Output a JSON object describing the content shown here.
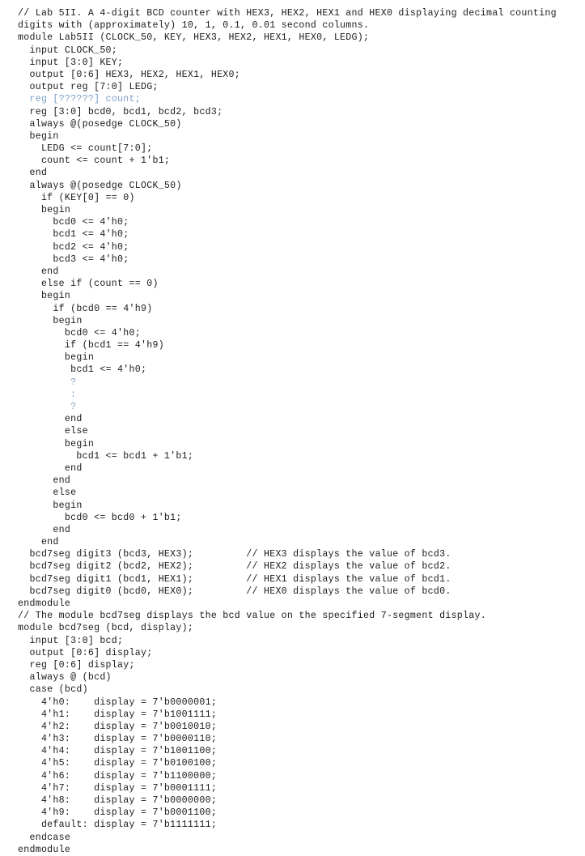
{
  "editor": {
    "language": "verilog",
    "background_color": "#ffffff",
    "text_color": "#1b1b1b",
    "highlight_color": "#7c9fc6",
    "font_kind": "monospace"
  },
  "code": {
    "lines": [
      {
        "text": "// Lab 5II. A 4-digit BCD counter with HEX3, HEX2, HEX1 and HEX0 displaying decimal counting",
        "highlighted": false
      },
      {
        "text": "digits with (approximately) 10, 1, 0.1, 0.01 second columns.",
        "highlighted": false
      },
      {
        "text": "module Lab5II (CLOCK_50, KEY, HEX3, HEX2, HEX1, HEX0, LEDG);",
        "highlighted": false
      },
      {
        "text": "  input CLOCK_50;",
        "highlighted": false
      },
      {
        "text": "  input [3:0] KEY;",
        "highlighted": false
      },
      {
        "text": "  output [0:6] HEX3, HEX2, HEX1, HEX0;",
        "highlighted": false
      },
      {
        "text": "  output reg [7:0] LEDG;",
        "highlighted": false
      },
      {
        "text": "  reg [??????] count;",
        "highlighted": true
      },
      {
        "text": "  reg [3:0] bcd0, bcd1, bcd2, bcd3;",
        "highlighted": false
      },
      {
        "text": "  always @(posedge CLOCK_50)",
        "highlighted": false
      },
      {
        "text": "  begin",
        "highlighted": false
      },
      {
        "text": "    LEDG <= count[7:0];",
        "highlighted": false
      },
      {
        "text": "    count <= count + 1'b1;",
        "highlighted": false
      },
      {
        "text": "  end",
        "highlighted": false
      },
      {
        "text": "  always @(posedge CLOCK_50)",
        "highlighted": false
      },
      {
        "text": "    if (KEY[0] == 0)",
        "highlighted": false
      },
      {
        "text": "    begin",
        "highlighted": false
      },
      {
        "text": "      bcd0 <= 4'h0;",
        "highlighted": false
      },
      {
        "text": "      bcd1 <= 4'h0;",
        "highlighted": false
      },
      {
        "text": "      bcd2 <= 4'h0;",
        "highlighted": false
      },
      {
        "text": "      bcd3 <= 4'h0;",
        "highlighted": false
      },
      {
        "text": "    end",
        "highlighted": false
      },
      {
        "text": "    else if (count == 0)",
        "highlighted": false
      },
      {
        "text": "    begin",
        "highlighted": false
      },
      {
        "text": "      if (bcd0 == 4'h9)",
        "highlighted": false
      },
      {
        "text": "      begin",
        "highlighted": false
      },
      {
        "text": "        bcd0 <= 4'h0;",
        "highlighted": false
      },
      {
        "text": "        if (bcd1 == 4'h9)",
        "highlighted": false
      },
      {
        "text": "        begin",
        "highlighted": false
      },
      {
        "text": "         bcd1 <= 4'h0;",
        "highlighted": false
      },
      {
        "text": "         ?",
        "highlighted": true
      },
      {
        "text": "         :",
        "highlighted": true
      },
      {
        "text": "         ?",
        "highlighted": true
      },
      {
        "text": "        end",
        "highlighted": false
      },
      {
        "text": "        else",
        "highlighted": false
      },
      {
        "text": "        begin",
        "highlighted": false
      },
      {
        "text": "          bcd1 <= bcd1 + 1'b1;",
        "highlighted": false
      },
      {
        "text": "        end",
        "highlighted": false
      },
      {
        "text": "      end",
        "highlighted": false
      },
      {
        "text": "      else",
        "highlighted": false
      },
      {
        "text": "      begin",
        "highlighted": false
      },
      {
        "text": "        bcd0 <= bcd0 + 1'b1;",
        "highlighted": false
      },
      {
        "text": "      end",
        "highlighted": false
      },
      {
        "text": "    end",
        "highlighted": false
      },
      {
        "text": "  bcd7seg digit3 (bcd3, HEX3);         // HEX3 displays the value of bcd3.",
        "highlighted": false
      },
      {
        "text": "  bcd7seg digit2 (bcd2, HEX2);         // HEX2 displays the value of bcd2.",
        "highlighted": false
      },
      {
        "text": "  bcd7seg digit1 (bcd1, HEX1);         // HEX1 displays the value of bcd1.",
        "highlighted": false
      },
      {
        "text": "  bcd7seg digit0 (bcd0, HEX0);         // HEX0 displays the value of bcd0.",
        "highlighted": false
      },
      {
        "text": "endmodule",
        "highlighted": false
      },
      {
        "text": "// The module bcd7seg displays the bcd value on the specified 7-segment display.",
        "highlighted": false
      },
      {
        "text": "module bcd7seg (bcd, display);",
        "highlighted": false
      },
      {
        "text": "  input [3:0] bcd;",
        "highlighted": false
      },
      {
        "text": "  output [0:6] display;",
        "highlighted": false
      },
      {
        "text": "  reg [0:6] display;",
        "highlighted": false
      },
      {
        "text": "  always @ (bcd)",
        "highlighted": false
      },
      {
        "text": "  case (bcd)",
        "highlighted": false
      },
      {
        "text": "    4'h0:    display = 7'b0000001;",
        "highlighted": false
      },
      {
        "text": "    4'h1:    display = 7'b1001111;",
        "highlighted": false
      },
      {
        "text": "    4'h2:    display = 7'b0010010;",
        "highlighted": false
      },
      {
        "text": "    4'h3:    display = 7'b0000110;",
        "highlighted": false
      },
      {
        "text": "    4'h4:    display = 7'b1001100;",
        "highlighted": false
      },
      {
        "text": "    4'h5:    display = 7'b0100100;",
        "highlighted": false
      },
      {
        "text": "    4'h6:    display = 7'b1100000;",
        "highlighted": false
      },
      {
        "text": "    4'h7:    display = 7'b0001111;",
        "highlighted": false
      },
      {
        "text": "    4'h8:    display = 7'b0000000;",
        "highlighted": false
      },
      {
        "text": "    4'h9:    display = 7'b0001100;",
        "highlighted": false
      },
      {
        "text": "    default: display = 7'b1111111;",
        "highlighted": false
      },
      {
        "text": "  endcase",
        "highlighted": false
      },
      {
        "text": "endmodule",
        "highlighted": false
      }
    ]
  }
}
